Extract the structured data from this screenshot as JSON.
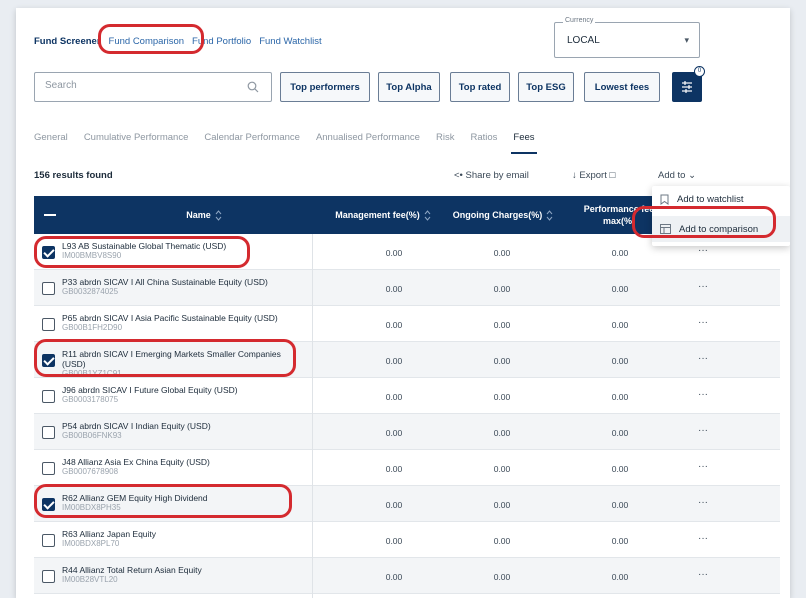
{
  "nav": {
    "tabs": [
      "Fund Screener",
      "Fund Comparison",
      "Fund Portfolio",
      "Fund Watchlist"
    ]
  },
  "currency": {
    "label": "Currency",
    "value": "LOCAL"
  },
  "search": {
    "placeholder": "Search"
  },
  "quick_filters": [
    "Top performers",
    "Top Alpha",
    "Top rated",
    "Top ESG",
    "Lowest fees"
  ],
  "filter_badge": "0",
  "view_tabs": [
    "General",
    "Cumulative Performance",
    "Calendar Performance",
    "Annualised Performance",
    "Risk",
    "Ratios",
    "Fees"
  ],
  "results_text": "156 results found",
  "actions": {
    "share": "Share by email",
    "export": "Export",
    "add_to": "Add to"
  },
  "menu": {
    "watchlist": "Add to watchlist",
    "comparison": "Add to comparison"
  },
  "columns": {
    "name": "Name",
    "mgmt": "Management fee(%)",
    "ongoing": "Ongoing Charges(%)",
    "perf": "Performance fee max(%)"
  },
  "rows": [
    {
      "name": "L93 AB Sustainable Global Thematic (USD)",
      "isin": "IM00BMBV8S90",
      "mgmt": "0.00",
      "ongoing": "0.00",
      "perf": "0.00",
      "checked": true
    },
    {
      "name": "P33 abrdn SICAV I All China Sustainable Equity (USD)",
      "isin": "GB0032874025",
      "mgmt": "0.00",
      "ongoing": "0.00",
      "perf": "0.00",
      "checked": false
    },
    {
      "name": "P65 abrdn SICAV I Asia Pacific Sustainable Equity (USD)",
      "isin": "GB00B1FH2D90",
      "mgmt": "0.00",
      "ongoing": "0.00",
      "perf": "0.00",
      "checked": false
    },
    {
      "name": "R11 abrdn SICAV I Emerging Markets Smaller Companies (USD)",
      "isin": "GB00B1YZ1C91",
      "mgmt": "0.00",
      "ongoing": "0.00",
      "perf": "0.00",
      "checked": true
    },
    {
      "name": "J96 abrdn SICAV I Future Global Equity (USD)",
      "isin": "GB0003178075",
      "mgmt": "0.00",
      "ongoing": "0.00",
      "perf": "0.00",
      "checked": false
    },
    {
      "name": "P54 abrdn SICAV I Indian Equity (USD)",
      "isin": "GB00B06FNK93",
      "mgmt": "0.00",
      "ongoing": "0.00",
      "perf": "0.00",
      "checked": false
    },
    {
      "name": "J48 Allianz Asia Ex China Equity (USD)",
      "isin": "GB0007678908",
      "mgmt": "0.00",
      "ongoing": "0.00",
      "perf": "0.00",
      "checked": false
    },
    {
      "name": "R62 Allianz GEM Equity High Dividend",
      "isin": "IM00BDX8PH35",
      "mgmt": "0.00",
      "ongoing": "0.00",
      "perf": "0.00",
      "checked": true
    },
    {
      "name": "R63 Allianz Japan Equity",
      "isin": "IM00BDX8PL70",
      "mgmt": "0.00",
      "ongoing": "0.00",
      "perf": "0.00",
      "checked": false
    },
    {
      "name": "R44 Allianz Total Return Asian Equity",
      "isin": "IM00B28VTL20",
      "mgmt": "0.00",
      "ongoing": "0.00",
      "perf": "0.00",
      "checked": false
    }
  ],
  "row_action": "···",
  "colors": {
    "primary": "#0d3463",
    "highlight": "#d42a2f",
    "link": "#2b66a8"
  }
}
